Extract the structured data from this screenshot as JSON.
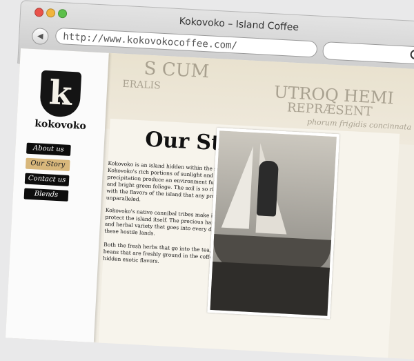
{
  "browser": {
    "window_title": "Kokovoko – Island Coffee",
    "url": "http://www.kokovokocoffee.com/",
    "back_glyph": "◀"
  },
  "site": {
    "logo_letter": "k",
    "logo_word": "kokovoko",
    "nav": [
      {
        "label": "About us",
        "active": false
      },
      {
        "label": "Our Story",
        "active": true
      },
      {
        "label": "Contact us",
        "active": false
      },
      {
        "label": "Blends",
        "active": false
      }
    ],
    "map_text": [
      "S CUM",
      "ERALIS",
      "UTROQ HEMI",
      "REPRÆSENT",
      "phorum frigidis concinnata"
    ],
    "story": {
      "title": "Our Story",
      "paragraphs": [
        "Kokovoko is an island hidden within the south seas. Kokovoko's rich portions of sunlight and generous amounts of precipitation produce an environment full of luscious fruits, and bright green foliage. The soil is so rich and marinated with the flavors of the island that any product it produces is unparalleled.",
        "Kokovoko's native cannibal tribes make its products rare, and protect the island itself. The precious harvest of whole beans, and herbal variety that goes into every drink is harvested in these hostile lands.",
        "Both the fresh herbs that go into the tea, and the whole beans that are freshly ground in the coffee contain these rare hidden exotic flavors."
      ]
    }
  }
}
